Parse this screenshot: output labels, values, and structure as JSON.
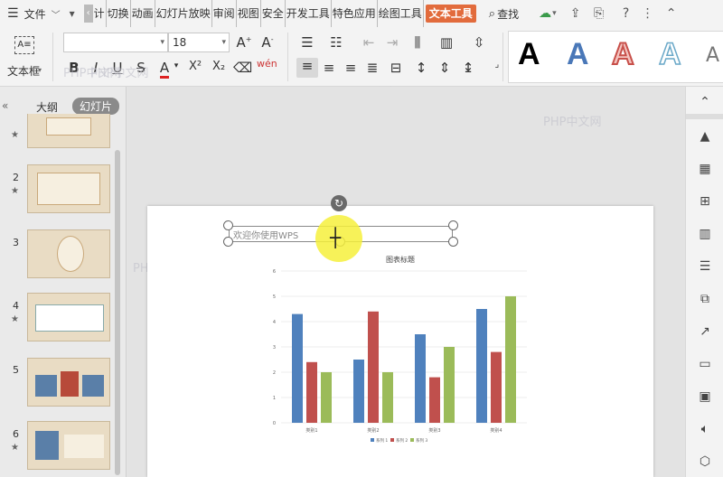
{
  "menubar": {
    "file_label": "文件",
    "tabs": [
      "计",
      "切换",
      "动画",
      "幻灯片放映",
      "审阅",
      "视图",
      "安全",
      "开发工具",
      "特色应用",
      "绘图工具"
    ],
    "active_tab": "文本工具",
    "search_label": "查找"
  },
  "ribbon": {
    "textbox_label": "文本框",
    "font_size": "18",
    "font_name": "",
    "wordart_letter": "A",
    "watermark1": "PHP中文网"
  },
  "leftpanel": {
    "tab_outline": "大纲",
    "tab_slides": "幻灯片",
    "slide_numbers": [
      "2",
      "3",
      "4",
      "5",
      "6"
    ],
    "watermark": "PHP中文网"
  },
  "slide": {
    "textbox_text": "欢迎你使用WPS"
  },
  "chart_data": {
    "type": "bar",
    "title": "图表标题",
    "categories": [
      "类别1",
      "类别2",
      "类别3",
      "类别4"
    ],
    "series": [
      {
        "name": "系列 1",
        "color": "#4f81bd",
        "values": [
          4.3,
          2.5,
          3.5,
          4.5
        ]
      },
      {
        "name": "系列 2",
        "color": "#c0504d",
        "values": [
          2.4,
          4.4,
          1.8,
          2.8
        ]
      },
      {
        "name": "系列 3",
        "color": "#9bbb59",
        "values": [
          2,
          2,
          3,
          5
        ]
      }
    ],
    "ylim": [
      0,
      6
    ],
    "yticks": [
      "0",
      "1",
      "2",
      "3",
      "4",
      "5",
      "6"
    ],
    "grid": true,
    "legend": "bottom"
  },
  "watermarks": {
    "top": "PHP中文网",
    "mid": "PHP中文网",
    "right": "PHP中文网"
  },
  "colors": {
    "active_tab": "#e26b3c",
    "highlight": "#f6f03c"
  }
}
